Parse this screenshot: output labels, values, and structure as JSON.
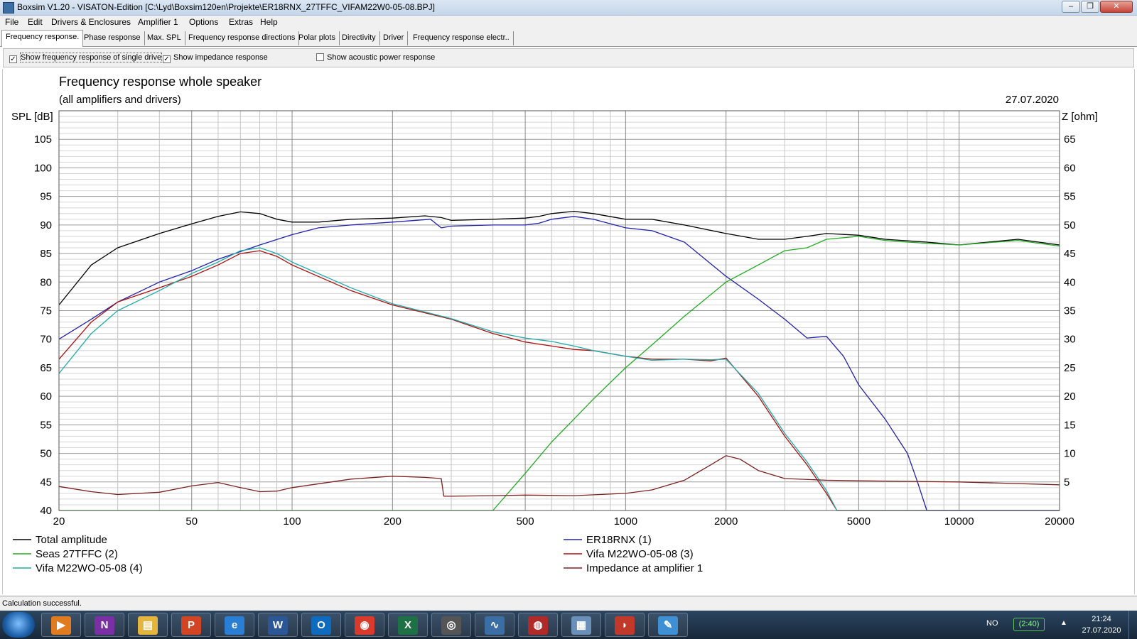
{
  "window": {
    "title": "Boxsim V1.20 - VISATON-Edition [C:\\Lyd\\Boxsim120en\\Projekte\\ER18RNX_27TFFC_VIFAM22W0-05-08.BPJ]",
    "buttons": {
      "minimize": "–",
      "restore": "❐",
      "close": "✕"
    }
  },
  "menu": [
    "File",
    "Edit",
    "Drivers & Enclosures",
    "Amplifier 1",
    "Options",
    "Extras",
    "Help"
  ],
  "tabs": [
    "Frequency response.",
    "Phase response",
    "Max. SPL",
    "Frequency response directions",
    "Polar plots",
    "Directivity",
    "Driver",
    "Frequency response electr.."
  ],
  "options": [
    {
      "label": "Show frequency response of single drive",
      "checked": true
    },
    {
      "label": "Show impedance response",
      "checked": true
    },
    {
      "label": "Show acoustic power response",
      "checked": false
    }
  ],
  "status": "Calculation successful.",
  "tray": {
    "language": "NO",
    "battery": "(2:40)",
    "arrow": "▲",
    "time": "21:24",
    "date": "27.07.2020"
  },
  "taskbar_apps": [
    {
      "name": "media-player",
      "glyph": "▶",
      "color": "#e07b20"
    },
    {
      "name": "onenote",
      "glyph": "N",
      "color": "#7b2fa5"
    },
    {
      "name": "file-explorer",
      "glyph": "▤",
      "color": "#e4b43c"
    },
    {
      "name": "powerpoint",
      "glyph": "P",
      "color": "#d14424"
    },
    {
      "name": "internet-explorer",
      "glyph": "e",
      "color": "#2a7fd4"
    },
    {
      "name": "word",
      "glyph": "W",
      "color": "#2b5797"
    },
    {
      "name": "outlook",
      "glyph": "O",
      "color": "#0f6bbd"
    },
    {
      "name": "chrome",
      "glyph": "◉",
      "color": "#d83b2b"
    },
    {
      "name": "excel",
      "glyph": "X",
      "color": "#1e7145"
    },
    {
      "name": "winisd",
      "glyph": "◎",
      "color": "#555555"
    },
    {
      "name": "boxsim-chart",
      "glyph": "∿",
      "color": "#3a6ea5"
    },
    {
      "name": "boxsim-speaker",
      "glyph": "◍",
      "color": "#b02a2a"
    },
    {
      "name": "calculator",
      "glyph": "▦",
      "color": "#6a8fb8"
    },
    {
      "name": "red-app",
      "glyph": "◗",
      "color": "#c0392b"
    },
    {
      "name": "paint",
      "glyph": "✎",
      "color": "#3f8fd4"
    }
  ],
  "chart_data": {
    "type": "line",
    "title": "Frequency response whole speaker",
    "subtitle": "(all amplifiers and drivers)",
    "date": "27.07.2020",
    "ylabel": "SPL [dB]",
    "y2label": "Z [ohm]",
    "xscale": "log",
    "xlim": [
      20,
      20000
    ],
    "ylim": [
      40,
      110
    ],
    "y2lim": [
      0,
      70
    ],
    "xticks": [
      20,
      50,
      100,
      200,
      500,
      1000,
      2000,
      5000,
      10000,
      20000
    ],
    "yticks": [
      40,
      45,
      50,
      55,
      60,
      65,
      70,
      75,
      80,
      85,
      90,
      95,
      100,
      105
    ],
    "y2ticks": [
      5,
      10,
      15,
      20,
      25,
      30,
      35,
      40,
      45,
      50,
      55,
      60,
      65
    ],
    "grid": true,
    "legend_position": "bottom",
    "series": [
      {
        "name": "Total amplitude",
        "color": "#000000",
        "axis": "left",
        "x": [
          20,
          25,
          30,
          40,
          50,
          60,
          70,
          80,
          90,
          100,
          120,
          150,
          200,
          250,
          280,
          300,
          400,
          500,
          550,
          600,
          700,
          800,
          1000,
          1200,
          1500,
          2000,
          2500,
          3000,
          3500,
          4000,
          5000,
          6000,
          8000,
          10000,
          15000,
          20000
        ],
        "y": [
          76,
          83,
          86,
          88.5,
          90.2,
          91.5,
          92.3,
          92,
          91,
          90.5,
          90.5,
          91,
          91.2,
          91.6,
          91.3,
          90.8,
          91,
          91.2,
          91.5,
          92,
          92.4,
          92,
          91,
          91,
          90,
          88.5,
          87.5,
          87.5,
          88,
          88.5,
          88.2,
          87.5,
          87,
          86.5,
          87.5,
          86.5
        ]
      },
      {
        "name": "ER18RNX (1)",
        "color": "#2222aa",
        "axis": "left",
        "x": [
          20,
          25,
          30,
          40,
          50,
          60,
          80,
          100,
          120,
          150,
          200,
          260,
          280,
          300,
          400,
          500,
          550,
          600,
          700,
          800,
          1000,
          1200,
          1500,
          2000,
          2500,
          3000,
          3500,
          4000,
          4500,
          5000,
          6000,
          7000,
          7500,
          8000,
          9000,
          20000
        ],
        "y": [
          70,
          73.5,
          76.5,
          80,
          82,
          84,
          86.5,
          88.3,
          89.5,
          90,
          90.5,
          91,
          89.5,
          89.8,
          90,
          90,
          90.3,
          91,
          91.5,
          91,
          89.5,
          89,
          87,
          81,
          77,
          73.5,
          70.2,
          70.5,
          67,
          62,
          56,
          50,
          45,
          40,
          40,
          40
        ]
      },
      {
        "name": "Seas 27TFFC (2)",
        "color": "#22aa22",
        "axis": "left",
        "x": [
          20,
          100,
          300,
          400,
          500,
          600,
          700,
          800,
          1000,
          1200,
          1500,
          2000,
          2500,
          3000,
          3500,
          4000,
          5000,
          6000,
          7000,
          8000,
          10000,
          15000,
          20000
        ],
        "y": [
          40,
          40,
          40,
          40,
          46.5,
          52,
          56,
          59.5,
          65,
          69,
          74,
          80,
          83,
          85.5,
          86,
          87.5,
          88,
          87.3,
          87,
          86.8,
          86.5,
          87.3,
          86.3
        ]
      },
      {
        "name": "Vifa M22WO-05-08 (3)",
        "color": "#aa1111",
        "axis": "left",
        "x": [
          20,
          25,
          30,
          40,
          50,
          60,
          70,
          80,
          90,
          100,
          150,
          200,
          300,
          400,
          500,
          600,
          700,
          800,
          1000,
          1200,
          1500,
          1800,
          2000,
          2500,
          3000,
          3500,
          4000,
          4300,
          20000
        ],
        "y": [
          66.5,
          73,
          76.5,
          79,
          81,
          83,
          85,
          85.5,
          84.5,
          83,
          78.5,
          76,
          73.5,
          71,
          69.5,
          68.8,
          68.2,
          68,
          67,
          66.5,
          66.5,
          66.2,
          66.7,
          60,
          53,
          48,
          43,
          40,
          40
        ]
      },
      {
        "name": "Vifa M22WO-05-08 (4)",
        "color": "#22aaaa",
        "axis": "left",
        "x": [
          20,
          25,
          30,
          40,
          50,
          60,
          70,
          80,
          90,
          100,
          150,
          200,
          300,
          400,
          500,
          600,
          700,
          800,
          1000,
          1200,
          1500,
          1800,
          2000,
          2500,
          3000,
          3500,
          4000,
          4300,
          20000
        ],
        "y": [
          64,
          71,
          75,
          78.5,
          81.5,
          83.5,
          85.5,
          86,
          85,
          83.5,
          79,
          76.2,
          73.6,
          71.3,
          70.2,
          69.6,
          68.8,
          68,
          67,
          66.3,
          66.5,
          66.4,
          66.5,
          60.5,
          53.5,
          48.5,
          43.5,
          40,
          40
        ]
      },
      {
        "name": "Impedance at amplifier 1",
        "color": "#7a2020",
        "axis": "right",
        "x": [
          20,
          25,
          30,
          40,
          50,
          60,
          70,
          80,
          90,
          100,
          150,
          200,
          250,
          280,
          285,
          300,
          400,
          500,
          700,
          1000,
          1200,
          1500,
          1800,
          2000,
          2200,
          2500,
          3000,
          4000,
          5000,
          10000,
          20000
        ],
        "y": [
          4.2,
          3.3,
          2.8,
          3.2,
          4.3,
          4.9,
          4,
          3.3,
          3.4,
          4,
          5.5,
          6,
          5.8,
          5.6,
          2.5,
          2.5,
          2.6,
          2.7,
          2.6,
          3,
          3.6,
          5.3,
          8,
          9.6,
          9,
          7,
          5.6,
          5.3,
          5.2,
          5.0,
          4.5
        ]
      }
    ]
  }
}
